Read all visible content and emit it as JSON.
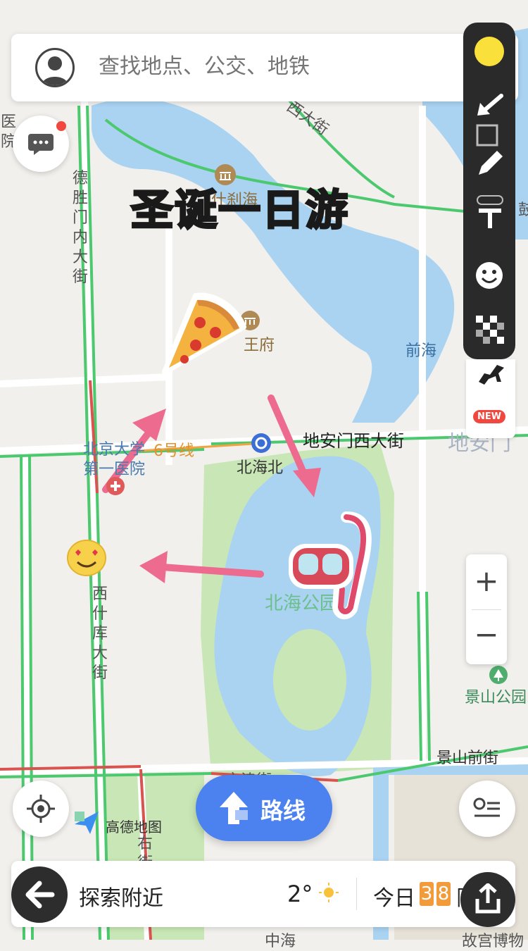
{
  "search": {
    "placeholder": "查找地点、公交、地铁"
  },
  "overlay_title": "圣诞一日游",
  "map_labels": {
    "hospital_left": "医院",
    "deshengmen": "德胜门内大街",
    "xi_dajie_top": "西大街",
    "shichahai": "什刹海",
    "wangfu": "王府",
    "qianhai": "前海",
    "beijing_daxue": "北京大学",
    "diyi_yiyuan": "第一医院",
    "line6": "6号线",
    "beihaibei": "北海北",
    "dianmen_xi": "地安门西大街",
    "dianmen_faded": "地安门",
    "xishiku": "西什库大街",
    "beihai_park": "北海公园",
    "jingshan_park": "景山公园",
    "jingshan_qianjie": "景山前街",
    "wenjin": "文津街",
    "amap": "高德地图",
    "youjie": "右街",
    "zhonghai": "中海",
    "gugong": "故宫博物",
    "gulou_partial": "鼓楼"
  },
  "route_button": {
    "label": "路线"
  },
  "bottom": {
    "explore": "探索附近",
    "temp": "2°",
    "today": "今日",
    "plate1": "3",
    "plate2": "8",
    "restrict": "限行"
  },
  "zoom": {
    "plus": "+",
    "minus": "−"
  },
  "toolbar": {
    "new_badge": "NEW"
  },
  "colors": {
    "road_green": "#4cc86e",
    "road_red": "#d9534f",
    "water": "#aad3f2",
    "park": "#c9e7b6",
    "accent_blue": "#4c82f0",
    "arrow_pink": "#ec6b8f",
    "title_fill": "#7be3c4"
  },
  "icons": [
    "user-avatar-icon",
    "message-icon",
    "mic-icon",
    "locate-icon",
    "list-icon",
    "share-icon",
    "back-icon",
    "sun-icon",
    "museum-icon",
    "subway-icon",
    "hospital-icon",
    "park-icon",
    "pizza-sticker",
    "heart-eyes-sticker",
    "snorkel-sticker",
    "arrow-icon",
    "pen-icon",
    "rectangle-icon",
    "text-icon",
    "emoji-icon",
    "mosaic-icon"
  ]
}
